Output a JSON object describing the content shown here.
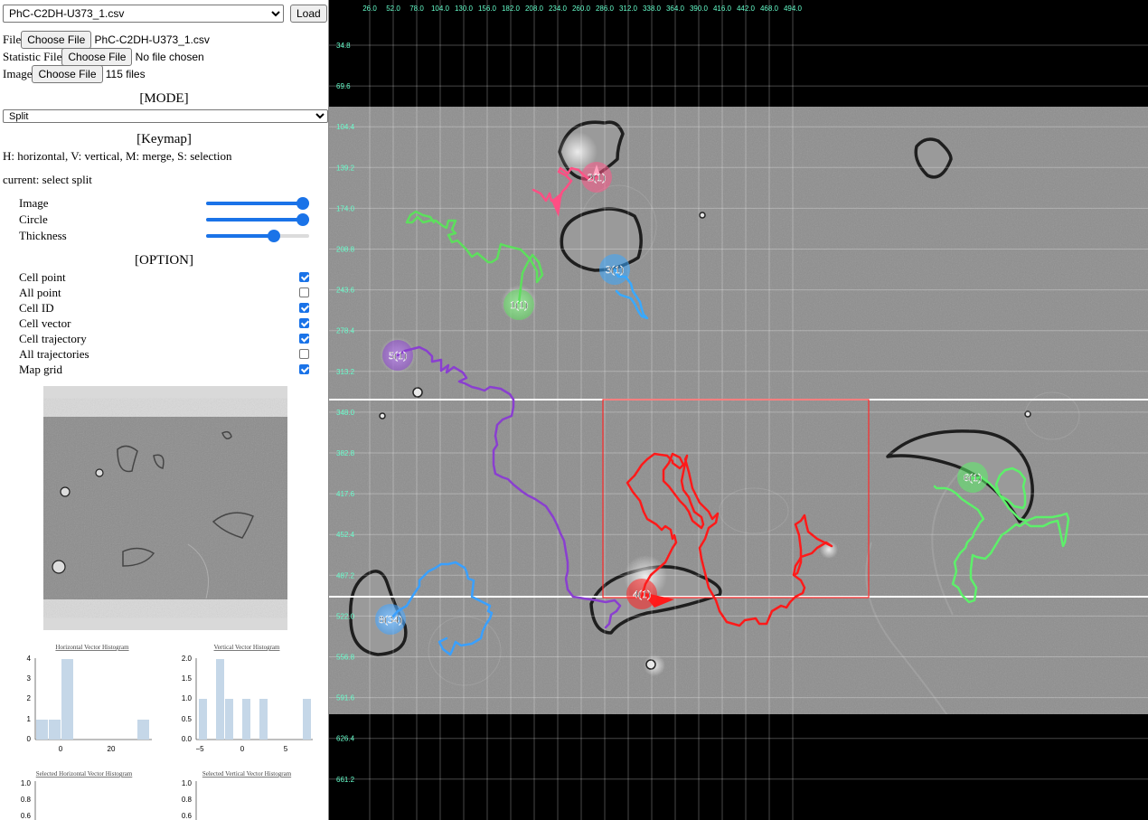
{
  "header": {
    "csv_select_value": "PhC-C2DH-U373_1.csv",
    "load_label": "Load"
  },
  "files": {
    "file_label": "File",
    "file_button": "Choose File",
    "file_value": "PhC-C2DH-U373_1.csv",
    "stat_label": "Statistic File",
    "stat_button": "Choose File",
    "stat_value": "No file chosen",
    "image_label": "Image",
    "image_button": "Choose File",
    "image_value": "115 files"
  },
  "mode": {
    "title": "[MODE]",
    "value": "Split"
  },
  "keymap": {
    "title": "[Keymap]",
    "text": "H: horizontal, V: vertical, M: merge, S: selection",
    "current": "current: select split"
  },
  "sliders": [
    {
      "label": "Image",
      "value": 1.0
    },
    {
      "label": "Circle",
      "value": 1.0
    },
    {
      "label": "Thickness",
      "value": 0.65
    }
  ],
  "option": {
    "title": "[OPTION]",
    "items": [
      {
        "label": "Cell point",
        "checked": true
      },
      {
        "label": "All point",
        "checked": false
      },
      {
        "label": "Cell ID",
        "checked": true
      },
      {
        "label": "Cell vector",
        "checked": true
      },
      {
        "label": "Cell trajectory",
        "checked": true
      },
      {
        "label": "All trajectories",
        "checked": false
      },
      {
        "label": "Map grid",
        "checked": true
      }
    ]
  },
  "histograms": {
    "horizontal": {
      "title": "Horizontal Vector Histogram",
      "y_ticks": [
        "4",
        "3",
        "2",
        "1",
        "0"
      ],
      "x_ticks": [
        "0",
        "20"
      ]
    },
    "vertical": {
      "title": "Vertical Vector Histogram",
      "y_ticks": [
        "2.0",
        "1.5",
        "1.0",
        "0.5",
        "0.0"
      ],
      "x_ticks": [
        "−5",
        "0",
        "5"
      ]
    },
    "sel_horizontal": {
      "title": "Selected Horizontal Vector Histogram",
      "y_ticks": [
        "1.0",
        "0.8",
        "0.6"
      ]
    },
    "sel_vertical": {
      "title": "Selected Vertical Vector Histogram",
      "y_ticks": [
        "1.0",
        "0.8",
        "0.6"
      ]
    }
  },
  "map": {
    "x_ticks": [
      "26.0",
      "52.0",
      "78.0",
      "104.0",
      "130.0",
      "156.0",
      "182.0",
      "208.0",
      "234.0",
      "260.0",
      "286.0",
      "312.0",
      "338.0",
      "364.0",
      "390.0",
      "416.0",
      "442.0",
      "468.0",
      "494.0"
    ],
    "y_ticks": [
      "34.8",
      "69.6",
      "104.4",
      "139.2",
      "174.0",
      "208.8",
      "243.6",
      "278.4",
      "313.2",
      "348.0",
      "382.8",
      "417.6",
      "452.4",
      "487.2",
      "522.0",
      "556.8",
      "591.6",
      "626.4",
      "661.2"
    ],
    "tick_color": "#66ffcc",
    "cells": [
      {
        "id": "1(1)",
        "color": "#5ddf5d"
      },
      {
        "id": "2(1)",
        "color": "#ff5a8a"
      },
      {
        "id": "3(1)",
        "color": "#3aa8ff"
      },
      {
        "id": "4(1)",
        "color": "#ff2020"
      },
      {
        "id": "5(1)",
        "color": "#8a3fd0"
      },
      {
        "id": "6(1)",
        "color": "#5df06a"
      },
      {
        "id": "8(34)",
        "color": "#3aa0ff"
      }
    ]
  }
}
